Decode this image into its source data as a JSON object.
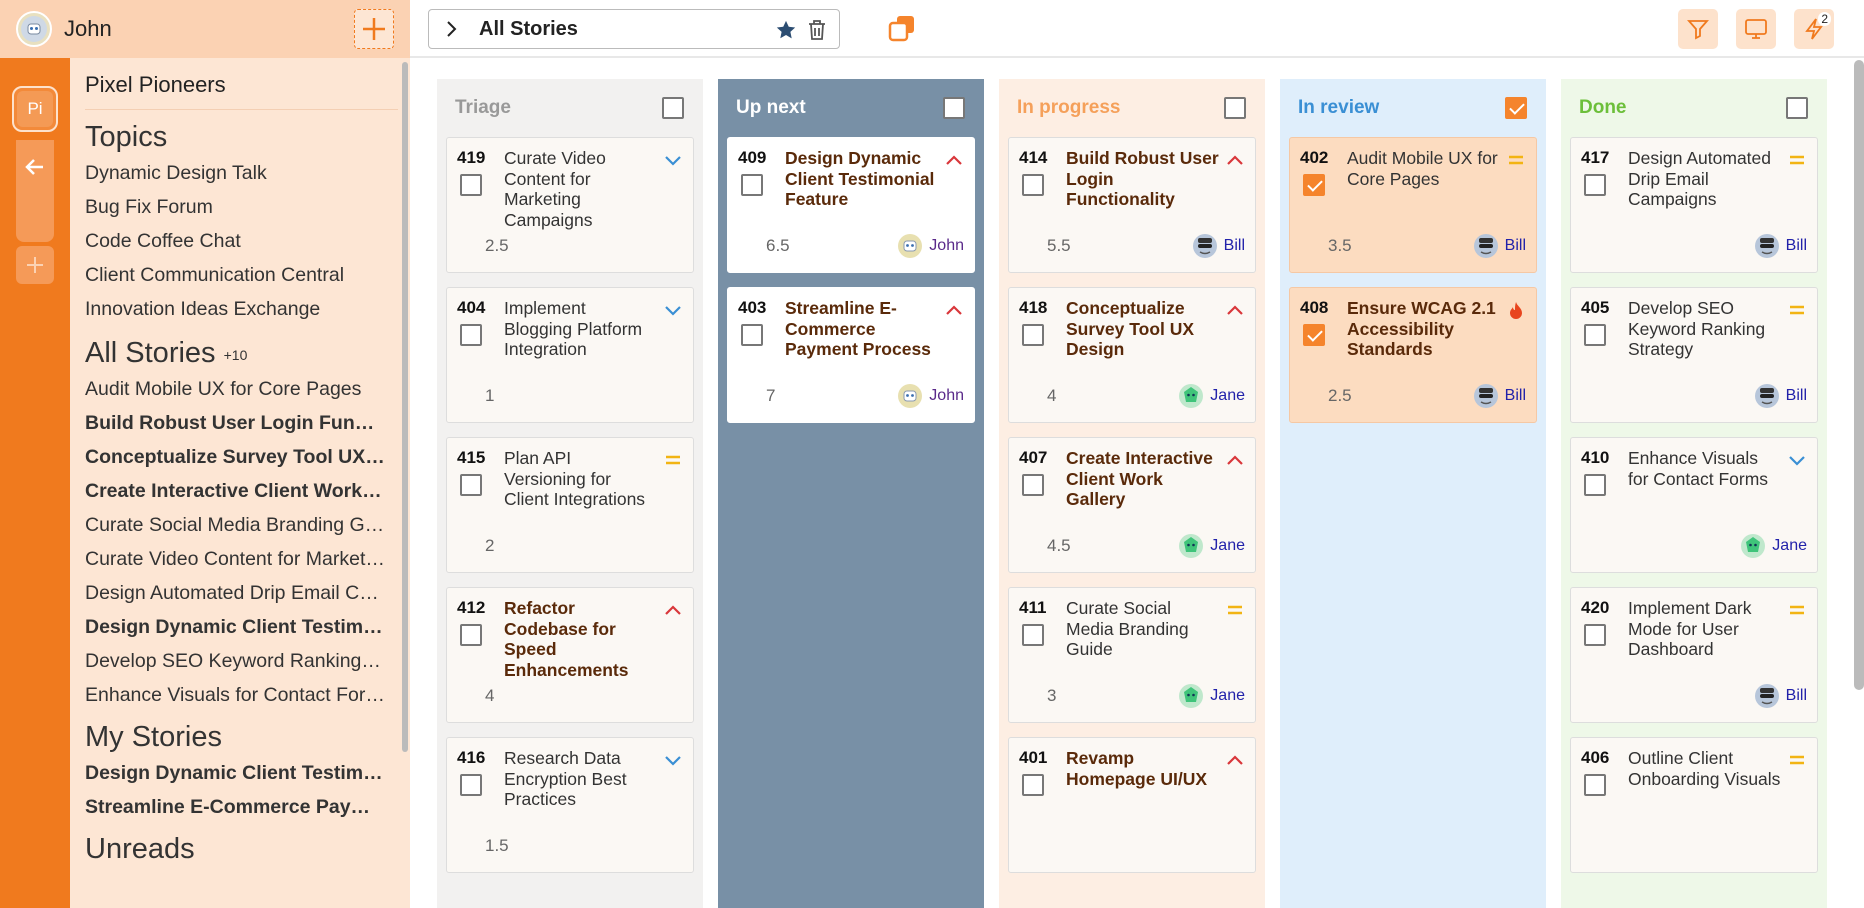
{
  "user": {
    "name": "John"
  },
  "rail": {
    "workspace_initials": "Pi"
  },
  "sidebar": {
    "org": "Pixel Pioneers",
    "topics_heading": "Topics",
    "topics": [
      "Dynamic Design Talk",
      "Bug Fix Forum",
      "Code Coffee Chat",
      "Client Communication Central",
      "Innovation Ideas Exchange"
    ],
    "all_stories_heading": "All Stories",
    "all_stories_more": "+10",
    "all_stories": [
      {
        "label": "Audit Mobile UX for Core Pages",
        "bold": false
      },
      {
        "label": "Build Robust User Login Functionality",
        "bold": true
      },
      {
        "label": "Conceptualize Survey Tool UX Design",
        "bold": true
      },
      {
        "label": "Create Interactive Client Work Gallery",
        "bold": true
      },
      {
        "label": "Curate Social Media Branding Guide",
        "bold": false
      },
      {
        "label": "Curate Video Content for Marketing Campaigns",
        "bold": false
      },
      {
        "label": "Design Automated Drip Email Campaigns",
        "bold": false
      },
      {
        "label": "Design Dynamic Client Testimonial Feature",
        "bold": true
      },
      {
        "label": "Develop SEO Keyword Ranking Strategy",
        "bold": false
      },
      {
        "label": "Enhance Visuals for Contact Forms",
        "bold": false
      }
    ],
    "my_stories_heading": "My Stories",
    "my_stories": [
      {
        "label": "Design Dynamic Client Testimonial Feature",
        "bold": true
      },
      {
        "label": "Streamline E-Commerce Payment Process",
        "bold": true
      }
    ],
    "unreads_heading": "Unreads"
  },
  "topbar": {
    "view_title": "All Stories",
    "notification_count": "2"
  },
  "colors": {
    "accent": "#f07a1e",
    "high": "#d9373b",
    "medium": "#f2b413",
    "low": "#3a8fd4",
    "urgent": "#e8451e"
  },
  "columns": [
    {
      "key": "triage",
      "title": "Triage",
      "bg": "#f2f1f0",
      "title_color": "#999999",
      "checked": false,
      "cards": [
        {
          "num": "419",
          "title": "Curate Video Content for Marketing Campaigns",
          "bold": false,
          "priority": "low",
          "estimate": "2.5",
          "assignee": null
        },
        {
          "num": "404",
          "title": "Implement Blogging Platform Integration",
          "bold": false,
          "priority": "low",
          "estimate": "1",
          "assignee": null
        },
        {
          "num": "415",
          "title": "Plan API Versioning for Client Integrations",
          "bold": false,
          "priority": "medium",
          "estimate": "2",
          "assignee": null
        },
        {
          "num": "412",
          "title": "Refactor Codebase for Speed Enhancements",
          "bold": true,
          "priority": "high",
          "estimate": "4",
          "assignee": null
        },
        {
          "num": "416",
          "title": "Research Data Encryption Best Practices",
          "bold": false,
          "priority": "low",
          "estimate": "1.5",
          "assignee": null
        }
      ]
    },
    {
      "key": "upnext",
      "title": "Up next",
      "bg": "#7890a6",
      "title_color": "#ffffff",
      "checked": false,
      "cards": [
        {
          "num": "409",
          "title": "Design Dynamic Client Testimonial Feature",
          "bold": true,
          "priority": "high",
          "estimate": "6.5",
          "assignee": "John"
        },
        {
          "num": "403",
          "title": "Streamline E-Commerce Payment Process",
          "bold": true,
          "priority": "high",
          "estimate": "7",
          "assignee": "John"
        }
      ]
    },
    {
      "key": "inprogress",
      "title": "In progress",
      "bg": "#fdeee3",
      "title_color": "#f5a05a",
      "checked": false,
      "cards": [
        {
          "num": "414",
          "title": "Build Robust User Login Functionality",
          "bold": true,
          "priority": "high",
          "estimate": "5.5",
          "assignee": "Bill"
        },
        {
          "num": "418",
          "title": "Conceptualize Survey Tool UX Design",
          "bold": true,
          "priority": "high",
          "estimate": "4",
          "assignee": "Jane"
        },
        {
          "num": "407",
          "title": "Create Interactive Client Work Gallery",
          "bold": true,
          "priority": "high",
          "estimate": "4.5",
          "assignee": "Jane"
        },
        {
          "num": "411",
          "title": "Curate Social Media Branding Guide",
          "bold": false,
          "priority": "medium",
          "estimate": "3",
          "assignee": "Jane"
        },
        {
          "num": "401",
          "title": "Revamp Homepage UI/UX",
          "bold": true,
          "priority": "high",
          "estimate": "",
          "assignee": null
        }
      ]
    },
    {
      "key": "inreview",
      "title": "In review",
      "bg": "#dfeefb",
      "title_color": "#3a8fd4",
      "checked": true,
      "cards": [
        {
          "num": "402",
          "title": "Audit Mobile UX for Core Pages",
          "bold": false,
          "priority": "medium",
          "estimate": "3.5",
          "assignee": "Bill",
          "checked": true
        },
        {
          "num": "408",
          "title": "Ensure WCAG 2.1 Accessibility Standards",
          "bold": true,
          "priority": "urgent",
          "estimate": "2.5",
          "assignee": "Bill",
          "checked": true
        }
      ]
    },
    {
      "key": "done",
      "title": "Done",
      "bg": "#eef8e8",
      "title_color": "#6cbf3a",
      "checked": false,
      "cards": [
        {
          "num": "417",
          "title": "Design Automated Drip Email Campaigns",
          "bold": false,
          "priority": "medium",
          "estimate": "",
          "assignee": "Bill"
        },
        {
          "num": "405",
          "title": "Develop SEO Keyword Ranking Strategy",
          "bold": false,
          "priority": "medium",
          "estimate": "",
          "assignee": "Bill"
        },
        {
          "num": "410",
          "title": "Enhance Visuals for Contact Forms",
          "bold": false,
          "priority": "low",
          "estimate": "",
          "assignee": "Jane"
        },
        {
          "num": "420",
          "title": "Implement Dark Mode for User Dashboard",
          "bold": false,
          "priority": "medium",
          "estimate": "",
          "assignee": "Bill"
        },
        {
          "num": "406",
          "title": "Outline Client Onboarding Visuals",
          "bold": false,
          "priority": "medium",
          "estimate": "",
          "assignee": null
        }
      ]
    }
  ]
}
